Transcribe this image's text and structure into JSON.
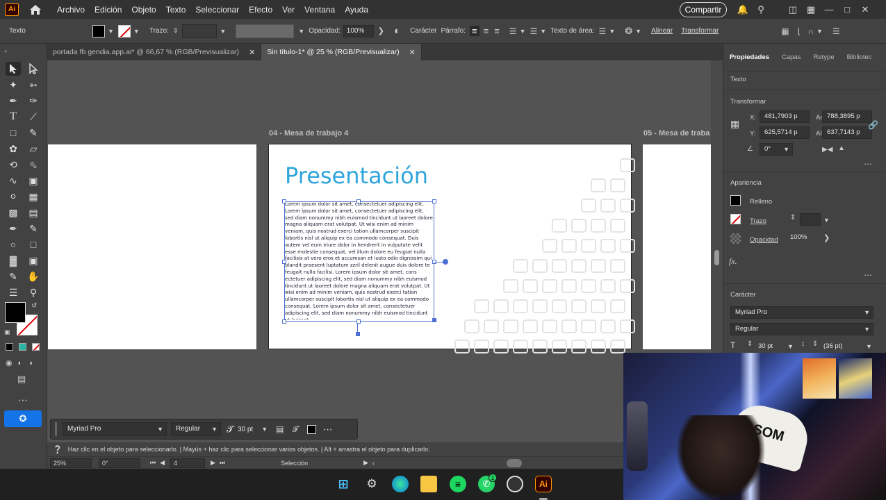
{
  "app": {
    "logo": "Ai"
  },
  "menu": [
    "Archivo",
    "Edición",
    "Objeto",
    "Texto",
    "Seleccionar",
    "Efecto",
    "Ver",
    "Ventana",
    "Ayuda"
  ],
  "share_label": "Compartir",
  "controlbar": {
    "type_label": "Texto",
    "stroke_label": "Trazo:",
    "opacity_label": "Opacidad:",
    "opacity_value": "100%",
    "character_label": "Carácter",
    "paragraph_label": "Párrafo:",
    "text_area_label": "Texto de área:",
    "align_label": "Alinear",
    "transform_label": "Transformar"
  },
  "tabs": [
    {
      "label": "portada fb gendia.app.ai* @ 66,67 % (RGB/Previsualizar)"
    },
    {
      "label": "Sin título-1* @ 25 % (RGB/Previsualizar)"
    }
  ],
  "artboards": {
    "current_label": "04 - Mesa de trabajo 4",
    "next_label": "05 - Mesa de traba"
  },
  "slide": {
    "title": "Presentación",
    "body": "Lorem ipsum dolor sit amet, consectetuer adipiscing elit. Lorem ipsum dolor sit amet, consectetuer adipiscing elit, sed diam nonummy nibh euismod tincidunt ut laoreet dolore magna aliquam erat volutpat. Ut wisi enim ad minim veniam, quis nostrud exerci tation ullamcorper suscipit lobortis nisl ut aliquip ex ea commodo consequat. Duis autem vel eum iriure dolor in hendrerit in vulputate velit esse molestie consequat, vel illum dolore eu feugiat nulla facilisis at vero eros et accumsan et iusto odio dignissim qui blandit praesent luptatum zzril delenit augue duis dolore te feugait nulla facilisi. Lorem ipsum dolor sit amet, cons ectetuer adipiscing elit, sed diam nonummy nibh euismod tincidunt ut laoreet dolore magna aliquam erat volutpat. Ut wisi enim ad minim veniam, quis nostrud exerci tation ullamcorper suscipit lobortis nisl ut aliquip ex ea commodo consequat. Lorem ipsum dolor sit amet, consectetuer adipiscing elit, sed diam nonummy nibh euismod tincidunt ut laoreet"
  },
  "panel": {
    "tabs": [
      "Propiedades",
      "Capas",
      "Retype",
      "Bibliotec"
    ],
    "object_type": "Texto",
    "transform_title": "Transformar",
    "x_label": "X:",
    "x_value": "481,7903 p",
    "y_label": "Y:",
    "y_value": "625,5714 p",
    "w_label": "An.:",
    "w_value": "788,3895 p",
    "h_label": "Al.:",
    "h_value": "637,7143 p",
    "angle_value": "0°",
    "appearance_title": "Apariencia",
    "fill_label": "Relleno",
    "stroke_label": "Trazo",
    "opacity_label": "Opacidad",
    "opacity_value": "100%",
    "fx_label": "fx.",
    "character_title": "Carácter",
    "font_family": "Myriad Pro",
    "font_style": "Regular",
    "font_size": "30 pt",
    "leading": "(36 pt)"
  },
  "floatbar": {
    "font_family": "Myriad Pro",
    "font_style": "Regular",
    "font_size": "30 pt"
  },
  "status": {
    "hint": "Haz clic en el objeto para seleccionarlo.  |  Mayús + haz clic para seleccionar varios objetos.  |  Alt + arrastra el objeto para duplicarlo.",
    "zoom": "25%",
    "rotation": "0°",
    "artboard_number": "4",
    "mode": "Selección"
  },
  "taskbar": {
    "notification_count": "1"
  },
  "webcam": {
    "hat_text": "SOM"
  }
}
